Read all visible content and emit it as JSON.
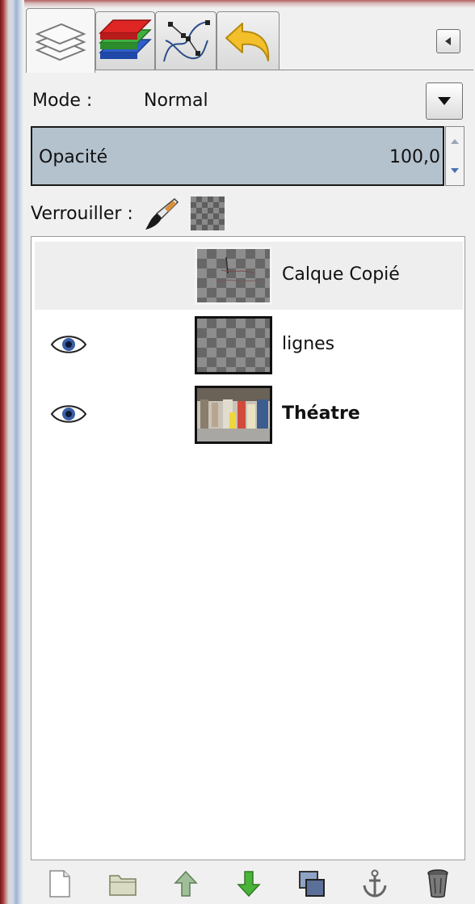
{
  "tabs": [
    {
      "icon": "layers-icon",
      "active": true
    },
    {
      "icon": "channels-icon",
      "active": false
    },
    {
      "icon": "paths-icon",
      "active": false
    },
    {
      "icon": "undo-history-icon",
      "active": false
    }
  ],
  "mode": {
    "label": "Mode :",
    "value": "Normal"
  },
  "opacity": {
    "label": "Opacité",
    "value": "100,0"
  },
  "lock": {
    "label": "Verrouiller :"
  },
  "layers": [
    {
      "name": "Calque Copié",
      "visible": false,
      "selected": true,
      "bold": false
    },
    {
      "name": "lignes",
      "visible": true,
      "selected": false,
      "bold": false
    },
    {
      "name": "Théatre",
      "visible": true,
      "selected": false,
      "bold": true
    }
  ],
  "toolbar": [
    "new-layer-icon",
    "new-layer-group-icon",
    "raise-layer-icon",
    "lower-layer-icon",
    "duplicate-layer-icon",
    "anchor-layer-icon",
    "delete-layer-icon"
  ],
  "colors": {
    "opacity_bar": "#b4c2ce",
    "selected_row": "#eeeeee"
  }
}
